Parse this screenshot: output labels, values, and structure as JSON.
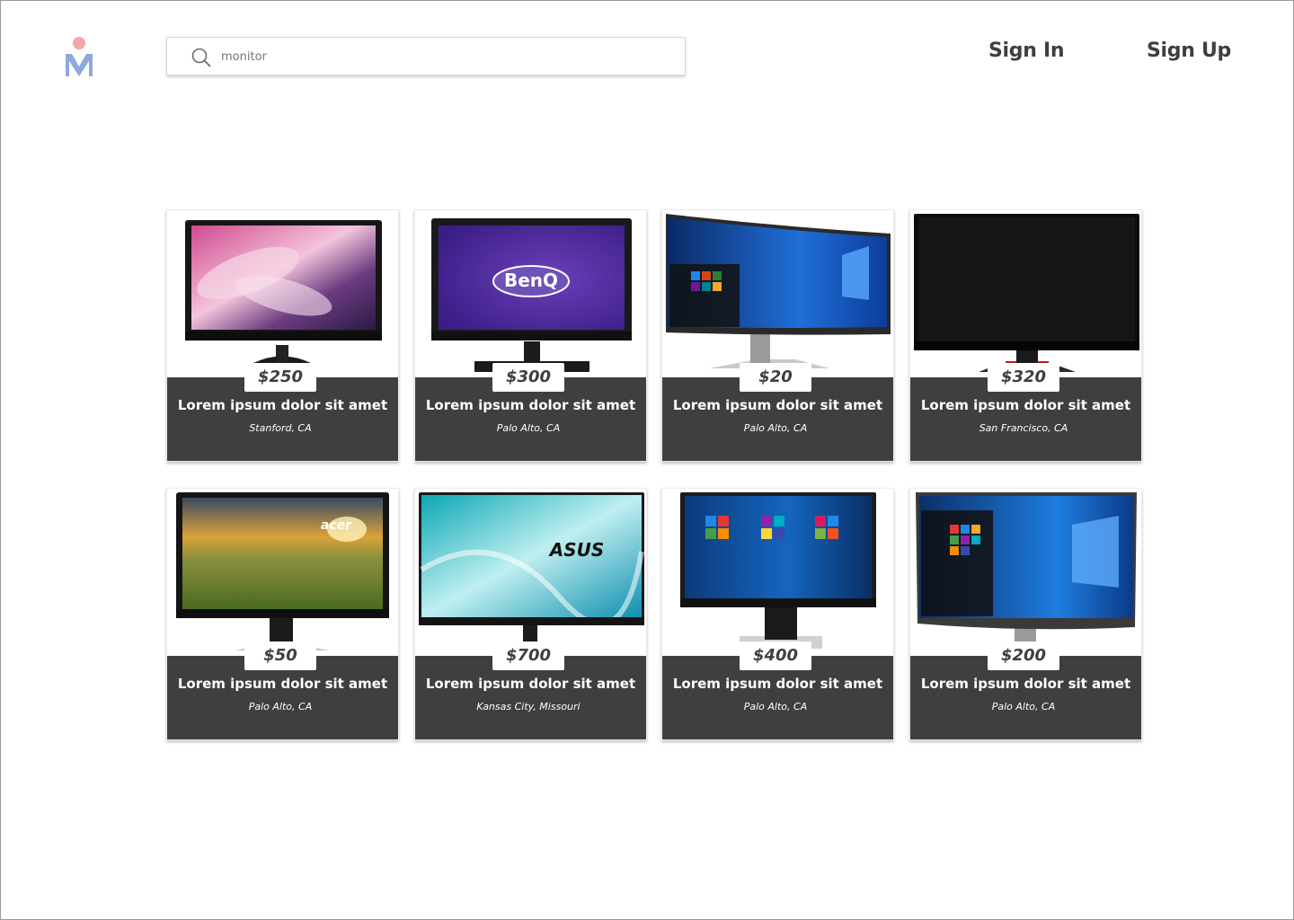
{
  "header": {
    "search": {
      "value": "",
      "placeholder": "monitor"
    },
    "sign_in_label": "Sign In",
    "sign_up_label": "Sign Up"
  },
  "colors": {
    "dark": "#3f3f41",
    "logo_dot": "#f2a7a6",
    "logo_m": "#8da9dd"
  },
  "listings": [
    {
      "price": "$250",
      "title": "Lorem ipsum dolor sit amet",
      "location": "Stanford, CA",
      "image": "lg-monitor-flower"
    },
    {
      "price": "$300",
      "title": "Lorem ipsum dolor sit amet",
      "location": "Palo Alto, CA",
      "image": "benq-monitor",
      "brand": "BenQ"
    },
    {
      "price": "$20",
      "title": "Lorem ipsum dolor sit amet",
      "location": "Palo Alto, CA",
      "image": "curved-windows-monitor"
    },
    {
      "price": "$320",
      "title": "Lorem ipsum dolor sit amet",
      "location": "San Francisco, CA",
      "image": "acer-monitor-black"
    },
    {
      "price": "$50",
      "title": "Lorem ipsum dolor sit amet",
      "location": "Palo Alto, CA",
      "image": "acer-monitor-landscape",
      "brand": "acer"
    },
    {
      "price": "$700",
      "title": "Lorem ipsum dolor sit amet",
      "location": "Kansas City, Missouri",
      "image": "asus-monitor",
      "brand": "ASUS"
    },
    {
      "price": "$400",
      "title": "Lorem ipsum dolor sit amet",
      "location": "Palo Alto, CA",
      "image": "dell-monitor-windows"
    },
    {
      "price": "$200",
      "title": "Lorem ipsum dolor sit amet",
      "location": "Palo Alto, CA",
      "image": "dell-monitor-windows-2"
    }
  ]
}
